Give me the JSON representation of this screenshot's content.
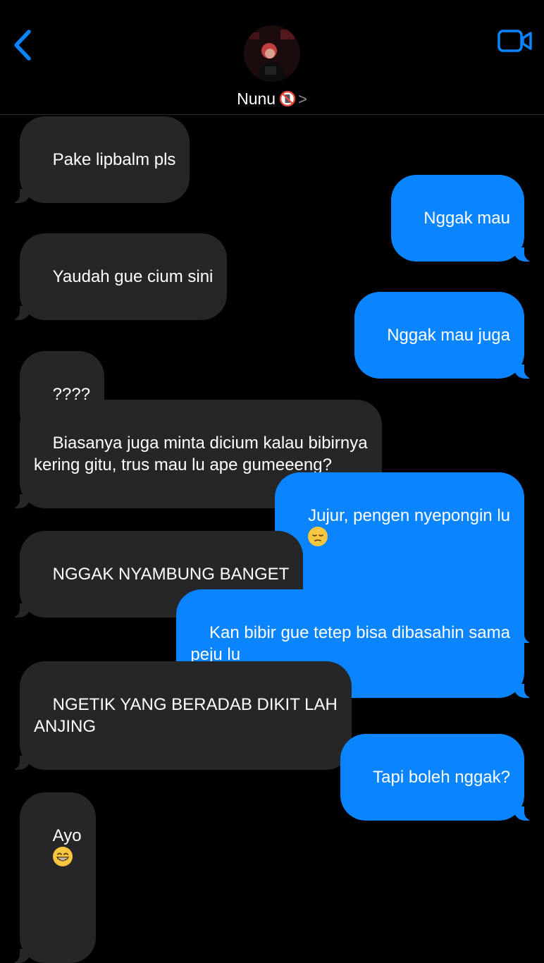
{
  "contact": {
    "name": "Nunu",
    "badge_icon": "no-mobile-phones-emoji",
    "chevron": ">"
  },
  "colors": {
    "accent": "#0a84ff",
    "incoming_bubble": "#262628",
    "background": "#000000"
  },
  "messages": [
    {
      "direction": "in",
      "text": "Pake lipbalm pls"
    },
    {
      "direction": "out",
      "text": "Nggak mau"
    },
    {
      "direction": "in",
      "text": "Yaudah gue cium sini"
    },
    {
      "direction": "out",
      "text": "Nggak mau juga"
    },
    {
      "direction": "in",
      "text": "????"
    },
    {
      "direction": "in",
      "text": "Biasanya juga minta dicium kalau bibirnya\nkering gitu, trus mau lu ape gumeeeng?"
    },
    {
      "direction": "out",
      "text": "Jujur, pengen nyepongin lu",
      "emoji": "pensive-face-emoji"
    },
    {
      "direction": "in",
      "text": "NGGAK NYAMBUNG BANGET"
    },
    {
      "direction": "out",
      "text": "Kan bibir gue tetep bisa dibasahin sama\npeju lu"
    },
    {
      "direction": "in",
      "text": "NGETIK YANG BERADAB DIKIT LAH\nANJING"
    },
    {
      "direction": "out",
      "text": "Tapi boleh nggak?"
    },
    {
      "direction": "in",
      "text": "Ayo",
      "emoji": "grinning-face-emoji"
    }
  ]
}
